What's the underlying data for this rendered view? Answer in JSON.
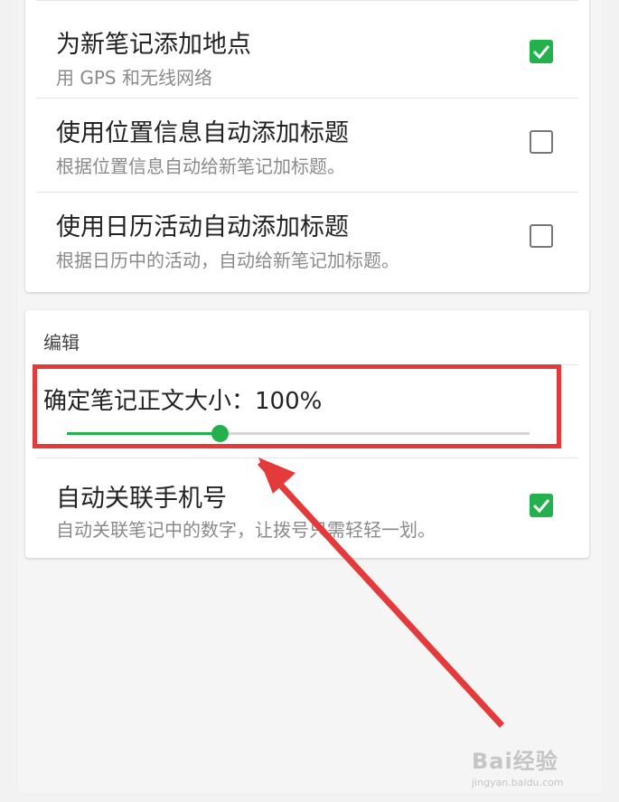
{
  "location_section": {
    "items": [
      {
        "title": "为新笔记添加地点",
        "subtitle": "用 GPS 和无线网络",
        "checked": true
      },
      {
        "title": "使用位置信息自动添加标题",
        "subtitle": "根据位置信息自动给新笔记加标题。",
        "checked": false
      },
      {
        "title": "使用日历活动自动添加标题",
        "subtitle": "根据日历中的活动，自动给新笔记加标题。",
        "checked": false
      }
    ]
  },
  "edit_section": {
    "header": "编辑",
    "font_size_slider": {
      "label": "确定笔记正文大小：100%",
      "value_fraction": 0.33
    },
    "auto_link_phone": {
      "title": "自动关联手机号",
      "subtitle": "自动关联笔记中的数字，让拨号只需轻轻一划。",
      "checked": true
    }
  },
  "annotation": {
    "highlight_color": "#e53a3a"
  },
  "watermark": {
    "logo": "Bai经验",
    "url": "jingyan.baidu.com"
  },
  "colors": {
    "accent": "#22b14c",
    "background": "#f5f5f5"
  }
}
